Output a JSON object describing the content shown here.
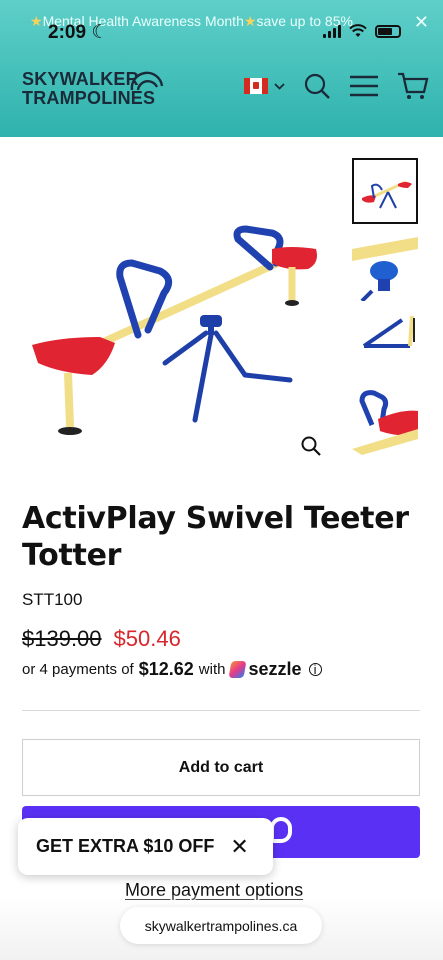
{
  "status_bar": {
    "time": "2:09"
  },
  "announcement": {
    "text": "Mental Health Awareness Month",
    "suffix": "save up to 85%",
    "close_symbol": "✕"
  },
  "header": {
    "brand_line1": "SKYWALKER",
    "brand_line2": "TRAMPOLINES",
    "country": "Canada",
    "icons": [
      "canada-flag-icon",
      "chevron-down-icon",
      "search-icon",
      "menu-icon",
      "cart-icon"
    ]
  },
  "gallery": {
    "thumbnails": [
      "full-teeter-totter",
      "seat-closeup",
      "leg-detail",
      "handle-detail"
    ]
  },
  "product": {
    "title": "ActivPlay Swivel Teeter Totter",
    "sku": "STT100",
    "price_original": "$139.00",
    "price_sale": "$50.46",
    "installment_prefix": "or 4 payments of",
    "installment_amount": "$12.62",
    "installment_with": "with",
    "installment_provider": "sezzle",
    "info_symbol": "i"
  },
  "actions": {
    "add_to_cart": "Add to cart",
    "more_payment_options": "More payment options"
  },
  "promo": {
    "text": "GET EXTRA $10 OFF",
    "close_symbol": "✕"
  },
  "browser": {
    "url": "skywalkertrampolines.ca"
  },
  "colors": {
    "header_teal": "#3cbab5",
    "sale_red": "#d9262c",
    "shop_pay_purple": "#5a31f4",
    "brand_dark": "#1a2a38"
  }
}
